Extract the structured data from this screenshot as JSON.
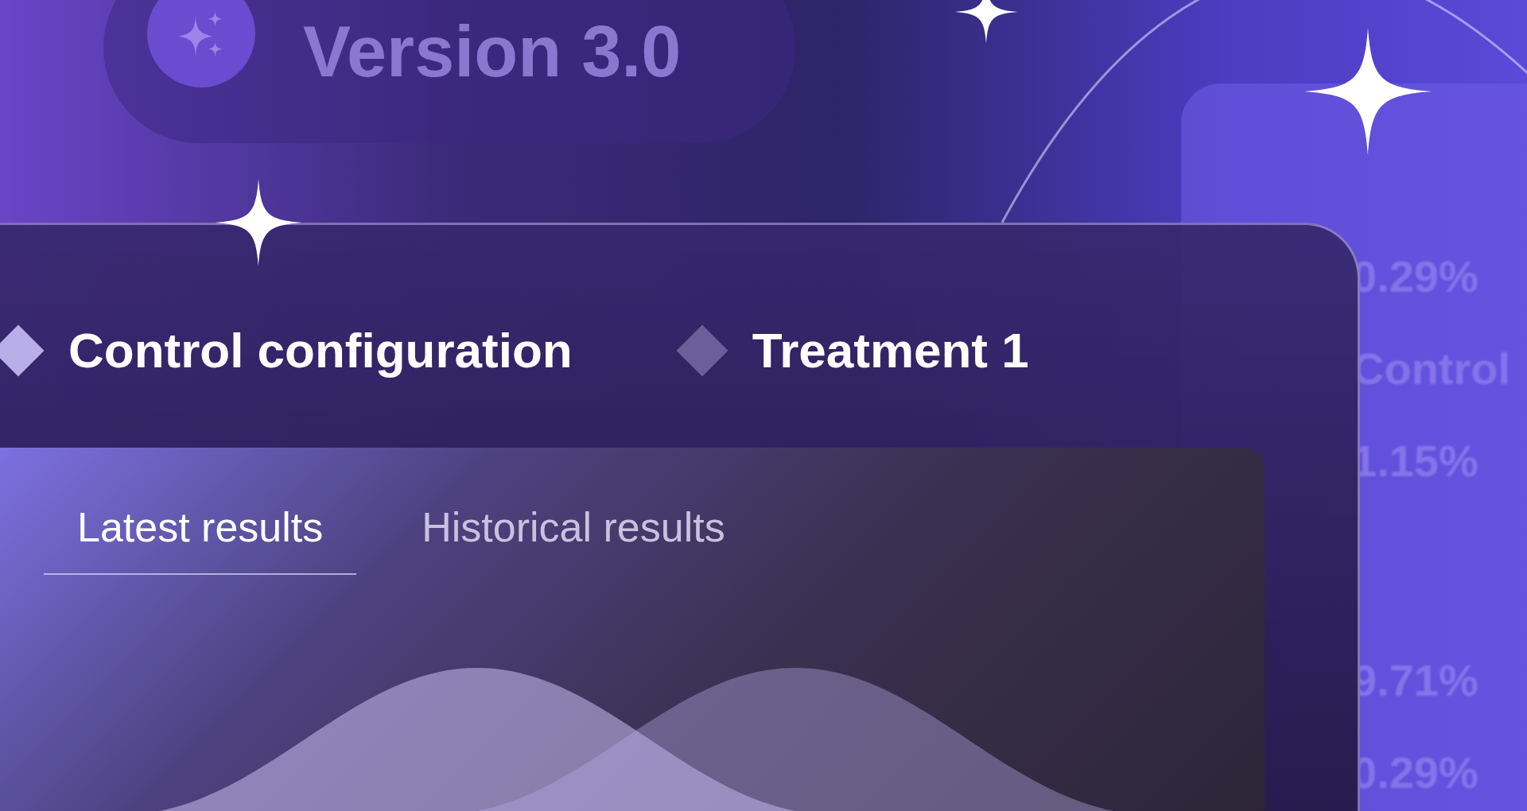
{
  "version_badge": {
    "label": "Version 3.0"
  },
  "background_card": {
    "values": [
      "0.29%",
      "Control",
      "1.15%",
      "9.71%",
      "0.29%"
    ]
  },
  "variants": [
    {
      "label": "Control configuration",
      "selected": true
    },
    {
      "label": "Treatment 1",
      "selected": false
    }
  ],
  "tabs": [
    {
      "label": "Latest results",
      "selected": true
    },
    {
      "label": "Historical results",
      "selected": false
    }
  ]
}
